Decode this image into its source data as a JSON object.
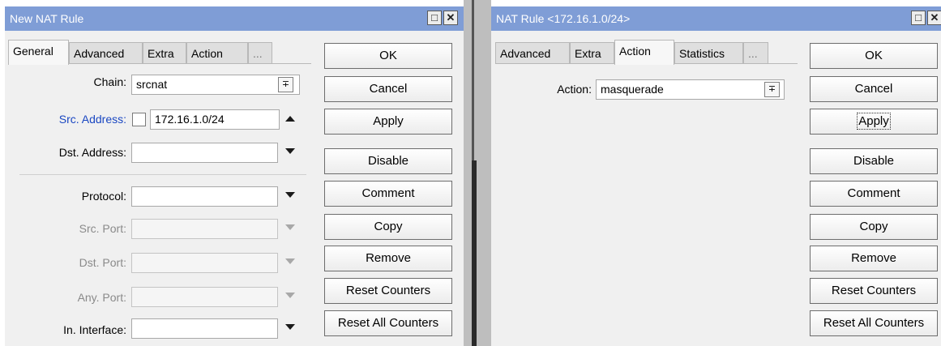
{
  "left_window": {
    "title": "New NAT Rule",
    "controls": {
      "maximize_glyph": "□",
      "close_glyph": "✕"
    },
    "tabs": [
      {
        "label": "General",
        "active": true
      },
      {
        "label": "Advanced",
        "active": false
      },
      {
        "label": "Extra",
        "active": false
      },
      {
        "label": "Action",
        "active": false
      },
      {
        "label": "...",
        "active": false
      }
    ],
    "fields": {
      "chain": {
        "label": "Chain:",
        "value": "srcnat",
        "dropdown_glyph": "∓"
      },
      "src_address": {
        "label": "Src. Address:",
        "value": "172.16.1.0/24"
      },
      "dst_address": {
        "label": "Dst. Address:",
        "value": ""
      },
      "protocol": {
        "label": "Protocol:",
        "value": ""
      },
      "src_port": {
        "label": "Src. Port:",
        "value": ""
      },
      "dst_port": {
        "label": "Dst. Port:",
        "value": ""
      },
      "any_port": {
        "label": "Any. Port:",
        "value": ""
      },
      "in_interface": {
        "label": "In. Interface:",
        "value": ""
      }
    },
    "buttons": {
      "ok": "OK",
      "cancel": "Cancel",
      "apply": "Apply",
      "disable": "Disable",
      "comment": "Comment",
      "copy": "Copy",
      "remove": "Remove",
      "reset_counters": "Reset Counters",
      "reset_all_counters": "Reset All Counters"
    }
  },
  "right_window": {
    "title": "NAT Rule <172.16.1.0/24>",
    "controls": {
      "maximize_glyph": "□",
      "close_glyph": "✕"
    },
    "tabs": [
      {
        "label": "Advanced",
        "active": false
      },
      {
        "label": "Extra",
        "active": false
      },
      {
        "label": "Action",
        "active": true
      },
      {
        "label": "Statistics",
        "active": false
      },
      {
        "label": "...",
        "active": false
      }
    ],
    "fields": {
      "action": {
        "label": "Action:",
        "value": "masquerade",
        "dropdown_glyph": "∓"
      }
    },
    "buttons": {
      "ok": "OK",
      "cancel": "Cancel",
      "apply": "Apply",
      "disable": "Disable",
      "comment": "Comment",
      "copy": "Copy",
      "remove": "Remove",
      "reset_counters": "Reset Counters",
      "reset_all_counters": "Reset All Counters"
    }
  },
  "colors": {
    "titlebar": "#7f9dd6",
    "window_bg": "#f0f0f0",
    "highlight_label": "#1a47c2",
    "disabled_label": "#8a8a8a"
  }
}
